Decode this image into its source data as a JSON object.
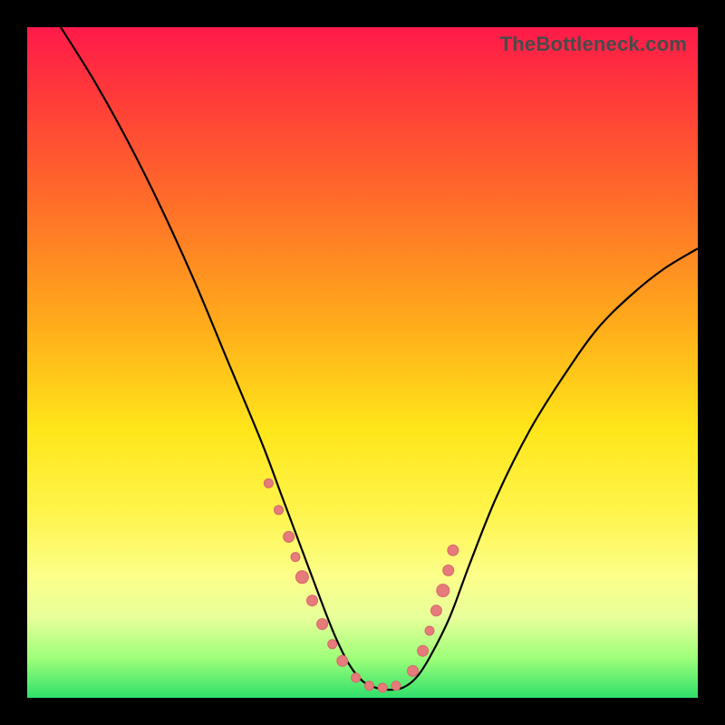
{
  "watermark": "TheBottleneck.com",
  "chart_data": {
    "type": "line",
    "title": "",
    "xlabel": "",
    "ylabel": "",
    "xlim": [
      0,
      100
    ],
    "ylim": [
      0,
      100
    ],
    "series": [
      {
        "name": "curve",
        "x": [
          5,
          10,
          15,
          20,
          25,
          30,
          35,
          38,
          41,
          44,
          46,
          48,
          50,
          52,
          54,
          56,
          58,
          60,
          63,
          66,
          70,
          75,
          80,
          85,
          90,
          95,
          100
        ],
        "y": [
          100,
          92,
          83,
          73,
          62,
          50,
          38,
          30,
          22,
          14,
          9,
          5,
          2.5,
          1.5,
          1.2,
          1.5,
          3,
          6,
          12,
          20,
          30,
          40,
          48,
          55,
          60,
          64,
          67
        ]
      }
    ],
    "points": {
      "name": "left-cluster-and-right-cluster",
      "x": [
        36,
        37.5,
        39,
        40,
        41,
        42.5,
        44,
        45.5,
        47,
        49,
        51,
        53,
        55,
        57.5,
        59,
        60,
        61,
        62,
        62.8,
        63.5
      ],
      "y": [
        32,
        28,
        24,
        21,
        18,
        14.5,
        11,
        8,
        5.5,
        3,
        1.8,
        1.5,
        1.8,
        4,
        7,
        10,
        13,
        16,
        19,
        22
      ],
      "r": [
        5,
        5,
        6,
        5,
        7,
        6,
        6,
        5,
        6,
        5,
        5,
        5,
        5,
        6,
        6,
        5,
        6,
        7,
        6,
        6
      ]
    },
    "background_gradient": {
      "top": "#ff1a4a",
      "bottom": "#2fe06a"
    }
  }
}
